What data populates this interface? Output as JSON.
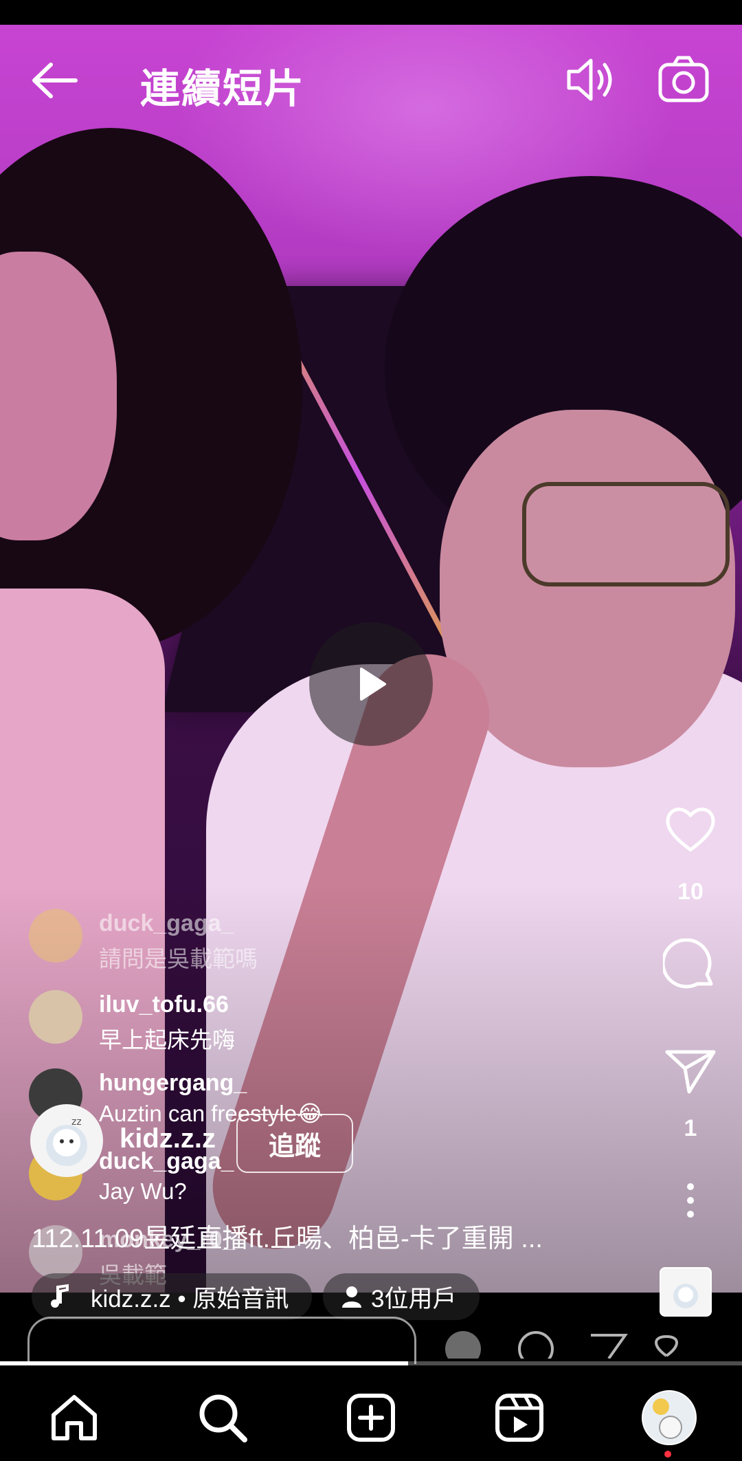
{
  "header": {
    "title": "連續短片"
  },
  "actions": {
    "like_count": "10",
    "share_count": "1"
  },
  "comments": [
    {
      "user": "duck_gaga_",
      "text": "請問是吳載範嗎"
    },
    {
      "user": "iluv_tofu.66",
      "text": "早上起床先嗨"
    },
    {
      "user": "hungergang_",
      "text": "Auztin can freestyle😂"
    },
    {
      "user": "duck_gaga_",
      "text": "Jay Wu?"
    },
    {
      "user": "monkey_r0_",
      "text": "吳載範"
    }
  ],
  "owner": {
    "username": "kidz.z.z",
    "follow_label": "追蹤"
  },
  "caption": "112.11.09昱廷直播ft.丘暘、柏邑-卡了重開 ...",
  "audio": {
    "label": "kidz.z.z • 原始音訊"
  },
  "users_chip": {
    "label": "3位用戶"
  },
  "progress": 0.55,
  "icons": {
    "back": "arrow-left-icon",
    "volume": "volume-icon",
    "camera": "camera-icon",
    "play": "play-icon",
    "like": "heart-icon",
    "comment": "comment-icon",
    "share": "send-icon",
    "more": "more-vertical-icon",
    "nav": [
      "home-icon",
      "search-icon",
      "create-icon",
      "reels-icon",
      "profile-avatar"
    ]
  },
  "colors": {
    "accent_dot": "#ff3040",
    "background": "#000000"
  }
}
